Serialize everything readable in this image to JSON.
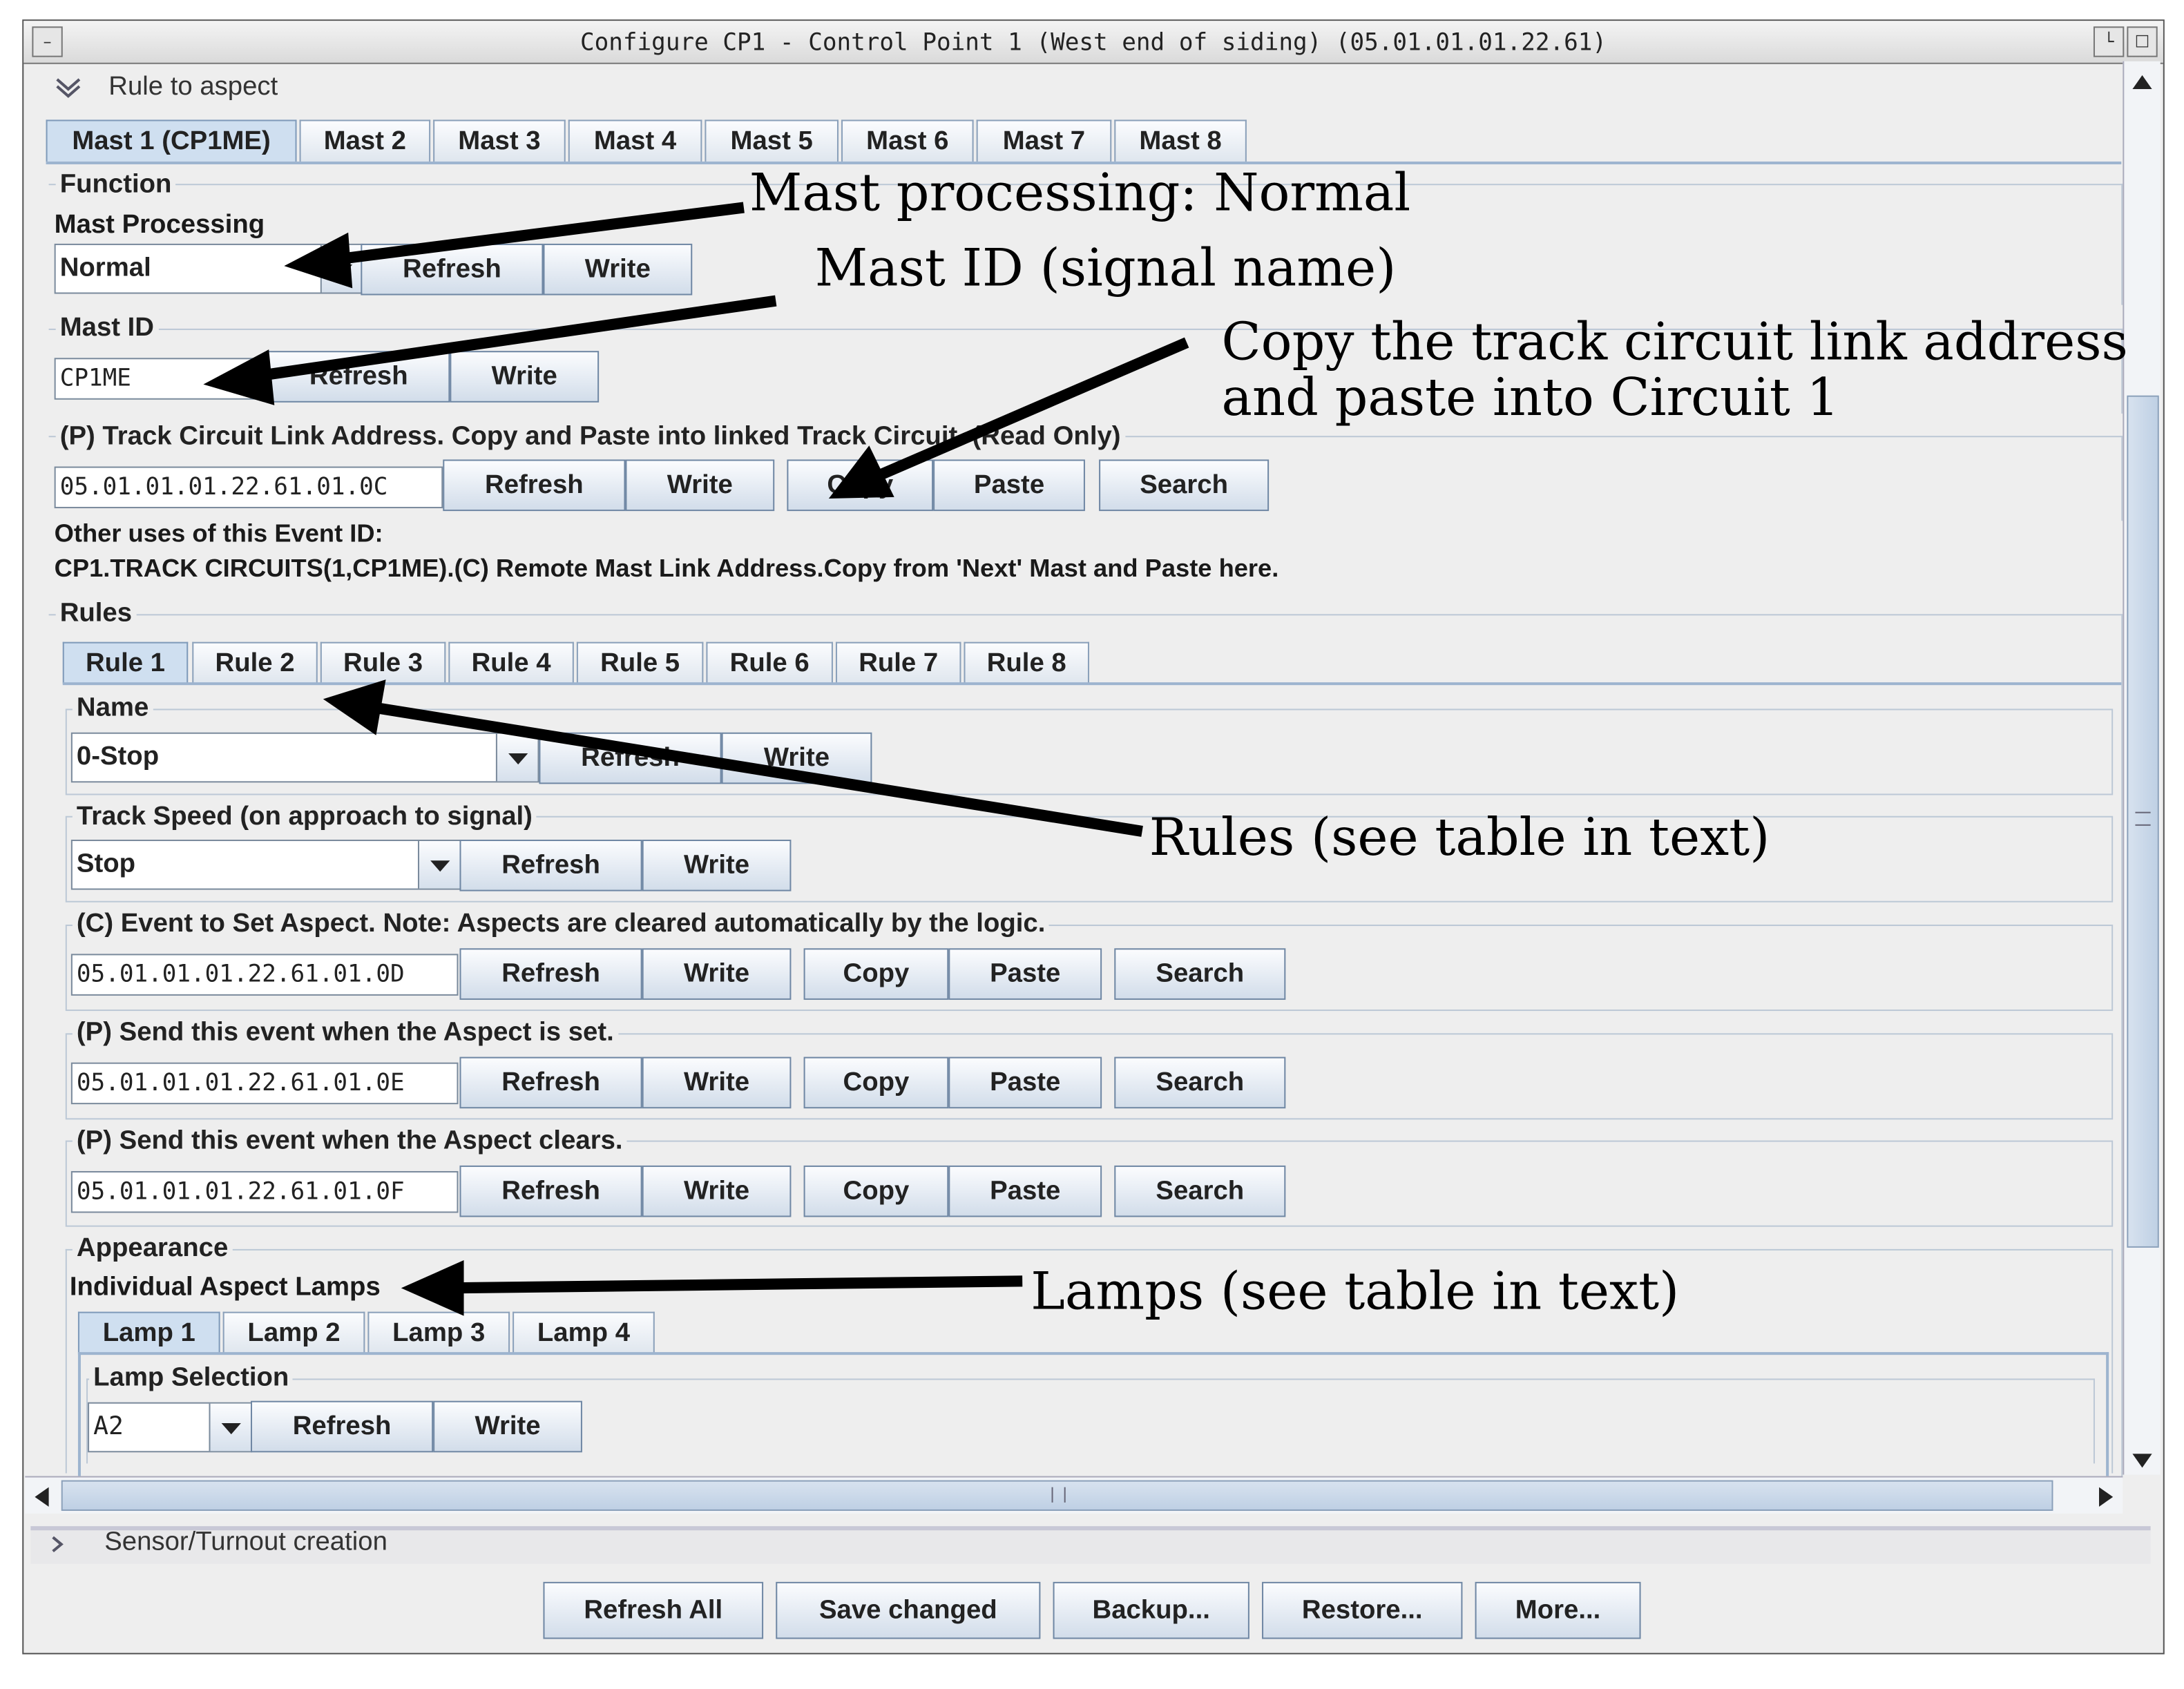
{
  "window": {
    "title": "Configure CP1 - Control Point 1 (West end of siding) (05.01.01.01.22.61)"
  },
  "section_rule_to_aspect": "Rule to aspect",
  "mast_tabs": [
    "Mast 1 (CP1ME)",
    "Mast 2",
    "Mast 3",
    "Mast 4",
    "Mast 5",
    "Mast 6",
    "Mast 7",
    "Mast 8"
  ],
  "function": {
    "group_label": "Function",
    "processing_label": "Mast Processing",
    "processing_value": "Normal",
    "refresh": "Refresh",
    "write": "Write",
    "mast_id_label": "Mast ID",
    "mast_id_value": "CP1ME",
    "track_circuit_label": "(P) Track Circuit Link Address. Copy and Paste into linked Track Circuit. (Read Only)",
    "track_circuit_value": "05.01.01.01.22.61.01.0C",
    "copy": "Copy",
    "paste": "Paste",
    "search": "Search",
    "other_uses_label": "Other uses of this Event ID:",
    "other_uses_value": "CP1.TRACK CIRCUITS(1,CP1ME).(C) Remote Mast Link Address.Copy from 'Next' Mast and Paste here."
  },
  "rules": {
    "group_label": "Rules",
    "tabs": [
      "Rule 1",
      "Rule 2",
      "Rule 3",
      "Rule 4",
      "Rule 5",
      "Rule 6",
      "Rule 7",
      "Rule 8"
    ],
    "name_label": "Name",
    "name_value": "0-Stop",
    "track_speed_label": "Track Speed (on approach to signal)",
    "track_speed_value": "Stop",
    "set_aspect_label": "(C) Event to Set Aspect. Note: Aspects are cleared automatically by the logic.",
    "set_aspect_value": "05.01.01.01.22.61.01.0D",
    "send_set_label": "(P) Send this event when the Aspect is set.",
    "send_set_value": "05.01.01.01.22.61.01.0E",
    "send_clear_label": "(P) Send this event when the Aspect clears.",
    "send_clear_value": "05.01.01.01.22.61.01.0F",
    "appearance_label": "Appearance",
    "lamps_label": "Individual Aspect Lamps",
    "lamp_tabs": [
      "Lamp 1",
      "Lamp 2",
      "Lamp 3",
      "Lamp 4"
    ],
    "lamp_selection_label": "Lamp Selection",
    "lamp_selection_value": "A2"
  },
  "section_sensor": "Sensor/Turnout creation",
  "footer": {
    "refresh_all": "Refresh All",
    "save_changed": "Save changed",
    "backup": "Backup...",
    "restore": "Restore...",
    "more": "More..."
  },
  "annotations": {
    "mast_processing": "Mast processing: Normal",
    "mast_id": "Mast ID (signal name)",
    "copy_line1": "Copy the track circuit link address",
    "copy_line2": "and paste into Circuit 1",
    "rules": "Rules (see table in text)",
    "lamps": "Lamps (see table in text)"
  }
}
